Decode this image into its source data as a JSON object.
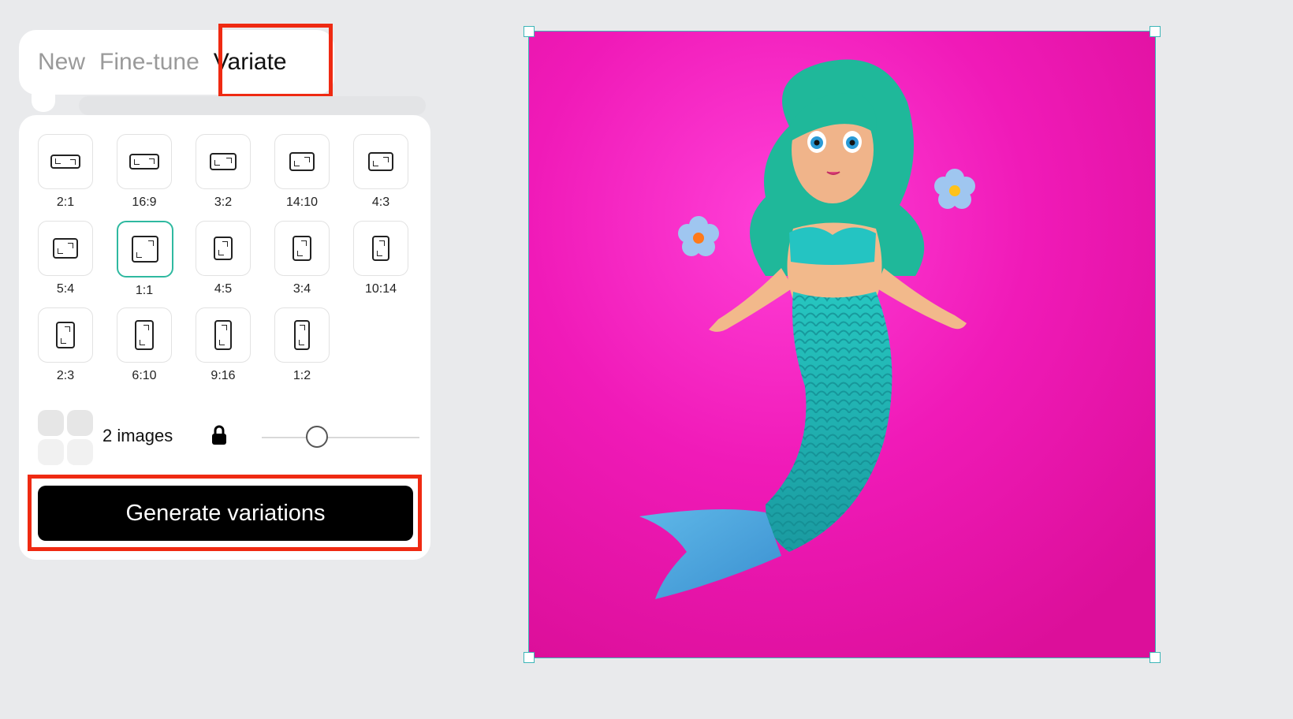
{
  "tabs": [
    {
      "label": "New",
      "active": false
    },
    {
      "label": "Fine-tune",
      "active": false
    },
    {
      "label": "Variate",
      "active": true
    }
  ],
  "aspect_ratios": [
    {
      "label": "2:1",
      "selected": false
    },
    {
      "label": "16:9",
      "selected": false
    },
    {
      "label": "3:2",
      "selected": false
    },
    {
      "label": "14:10",
      "selected": false
    },
    {
      "label": "4:3",
      "selected": false
    },
    {
      "label": "5:4",
      "selected": false
    },
    {
      "label": "1:1",
      "selected": true
    },
    {
      "label": "4:5",
      "selected": false
    },
    {
      "label": "3:4",
      "selected": false
    },
    {
      "label": "10:14",
      "selected": false
    },
    {
      "label": "2:3",
      "selected": false
    },
    {
      "label": "6:10",
      "selected": false
    },
    {
      "label": "9:16",
      "selected": false
    },
    {
      "label": "1:2",
      "selected": false
    }
  ],
  "image_count": {
    "label": "2 images",
    "locked": true,
    "icon": "lock-icon"
  },
  "generate_button": {
    "label": "Generate variations"
  },
  "canvas": {
    "image_subject": "toy mermaid figure on pink background",
    "colors": {
      "background": "#f01ab8",
      "selection": "#3db6b8"
    }
  },
  "highlight_color": "#ef2a12",
  "accent_color": "#2fb9a0"
}
